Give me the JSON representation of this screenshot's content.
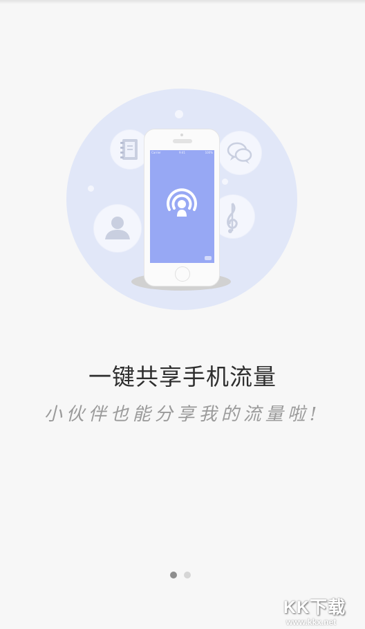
{
  "colors": {
    "background": "#f7f7f7",
    "hero_circle": "#e1e7f8",
    "phone_screen": "#97a8f4",
    "icon_gray": "#c9cfe0",
    "title": "#2e2e2e",
    "subtitle": "#9a9a9a",
    "pager_active": "#8e8e8e",
    "pager_inactive": "#d6d6d6"
  },
  "hero": {
    "icons": [
      "notebook-icon",
      "chat-bubbles-icon",
      "person-icon",
      "music-note-icon",
      "wifi-hotspot-icon"
    ],
    "phone_status": {
      "left": "Carrier",
      "mid": "9:41",
      "right": "100%"
    }
  },
  "title": "一键共享手机流量",
  "subtitle": "小伙伴也能分享我的流量啦!",
  "pager": {
    "total": 2,
    "active_index": 0
  },
  "watermark": {
    "logo_text": "KK下载",
    "url": "www.kkx.net"
  }
}
